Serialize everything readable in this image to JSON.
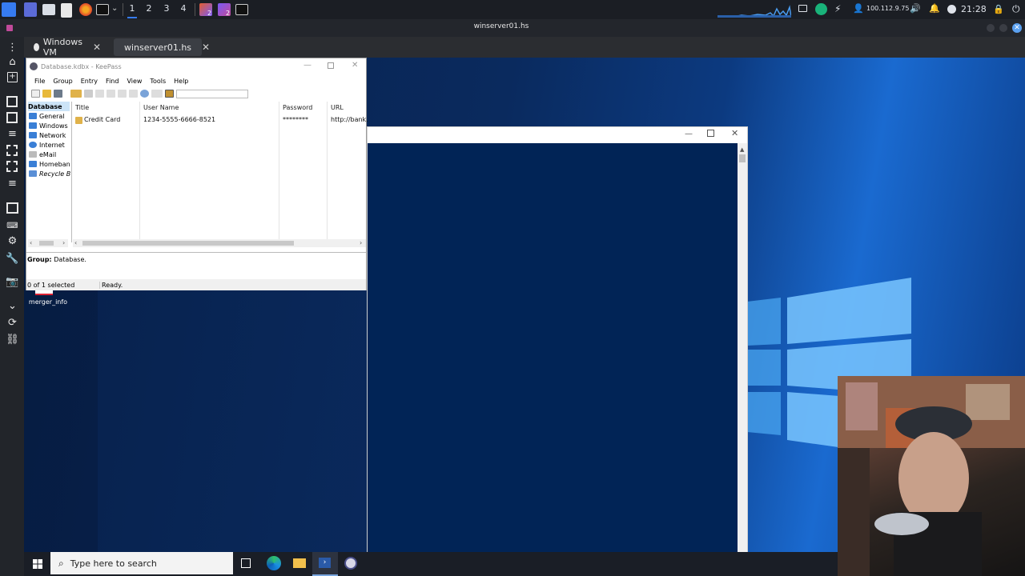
{
  "topbar": {
    "workspaces": [
      "1",
      "2",
      "3",
      "4"
    ],
    "badge_a": "2",
    "badge_b": "2",
    "ip_address": "100.112.9.75",
    "clock": "21:28"
  },
  "viewer": {
    "title": "winserver01.hs",
    "tabs": [
      {
        "label": "Windows VM"
      },
      {
        "label": "winserver01.hs"
      }
    ]
  },
  "keepass": {
    "title": "Database.kdbx - KeePass",
    "menu": [
      "File",
      "Group",
      "Entry",
      "Find",
      "View",
      "Tools",
      "Help"
    ],
    "tree": [
      {
        "label": "Database",
        "bold": true
      },
      {
        "label": "General"
      },
      {
        "label": "Windows"
      },
      {
        "label": "Network"
      },
      {
        "label": "Internet"
      },
      {
        "label": "eMail"
      },
      {
        "label": "Homeban"
      },
      {
        "label": "Recycle Bi",
        "italic": true
      }
    ],
    "columns": [
      "Title",
      "User Name",
      "Password",
      "URL"
    ],
    "rows": [
      {
        "title": "Credit Card",
        "user": "1234-5555-6666-8521",
        "password": "********",
        "url": "http://bank.c"
      }
    ],
    "detail_label": "Group:",
    "detail_value": "Database.",
    "status_selected": "0 of 1 selected",
    "status_state": "Ready."
  },
  "desktop": {
    "icon_label": "merger_info"
  },
  "taskbar": {
    "search_placeholder": "Type here to search"
  },
  "colors": {
    "kali_panel": "#1b1e24",
    "powershell_bg": "#012456",
    "desktop_blue": "#0c3a80"
  }
}
